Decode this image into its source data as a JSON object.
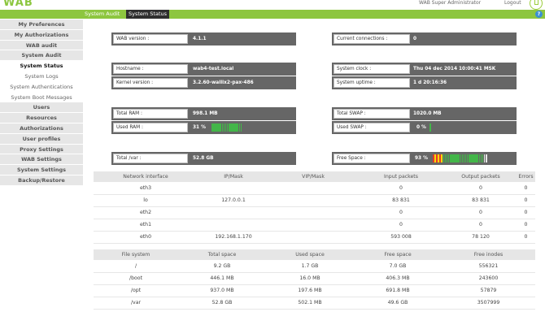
{
  "header": {
    "logo": "WAB",
    "user": "WAB Super Administrator",
    "logout": "Logout"
  },
  "menubar": {
    "crumbs": [
      "System Audit",
      "System Status"
    ],
    "help": "?"
  },
  "sidebar": {
    "items": [
      {
        "label": "My Preferences",
        "kind": "main"
      },
      {
        "label": "My Authorizations",
        "kind": "main"
      },
      {
        "label": "WAB audit",
        "kind": "main"
      },
      {
        "label": "System Audit",
        "kind": "main"
      },
      {
        "label": "System Status",
        "kind": "current"
      },
      {
        "label": "System Logs",
        "kind": "sub"
      },
      {
        "label": "System Authentications",
        "kind": "sub"
      },
      {
        "label": "System Boot Messages",
        "kind": "sub"
      },
      {
        "label": "Users",
        "kind": "main"
      },
      {
        "label": "Resources",
        "kind": "main"
      },
      {
        "label": "Authorizations",
        "kind": "main"
      },
      {
        "label": "User profiles",
        "kind": "main"
      },
      {
        "label": "Proxy Settings",
        "kind": "main"
      },
      {
        "label": "WAB Settings",
        "kind": "main"
      },
      {
        "label": "System Settings",
        "kind": "main"
      },
      {
        "label": "Backup/Restore",
        "kind": "main"
      }
    ]
  },
  "status": {
    "wab_version": {
      "label": "WAB version :",
      "value": "4.1.1"
    },
    "connections": {
      "label": "Current connections :",
      "value": "0"
    },
    "hostname": {
      "label": "Hostname :",
      "value": "wab4-test.local"
    },
    "kernel": {
      "label": "Kernel version :",
      "value": "3.2.60-wallix2-pax-486"
    },
    "clock": {
      "label": "System clock :",
      "value": "Thu 04 dec 2014 10:00:41 MSK"
    },
    "uptime": {
      "label": "System uptime :",
      "value": "1 d 20:16:36"
    },
    "total_ram": {
      "label": "Total RAM :",
      "value": "998.1 MB"
    },
    "used_ram": {
      "label": "Used RAM :",
      "value": "31 %",
      "level": 0.31
    },
    "total_swap": {
      "label": "Total SWAP :",
      "value": "1020.0 MB"
    },
    "used_swap": {
      "label": "Used SWAP :",
      "value": "0 %",
      "level": 0.0
    },
    "total_var": {
      "label": "Total /var :",
      "value": "52.8 GB"
    },
    "free_space": {
      "label": "Free Space :",
      "value": "93 %",
      "level": 0.93
    }
  },
  "network": {
    "headers": [
      "Network interface",
      "IP/Mask",
      "VIP/Mask",
      "Input packets",
      "Output packets",
      "Errors"
    ],
    "rows": [
      [
        "eth3",
        "",
        "",
        "0",
        "0",
        "0"
      ],
      [
        "lo",
        "127.0.0.1",
        "",
        "83 831",
        "83 831",
        "0"
      ],
      [
        "eth2",
        "",
        "",
        "0",
        "0",
        "0"
      ],
      [
        "eth1",
        "",
        "",
        "0",
        "0",
        "0"
      ],
      [
        "eth0",
        "192.168.1.170",
        "",
        "593 008",
        "78 120",
        "0"
      ]
    ]
  },
  "filesystems": {
    "headers": [
      "File system",
      "Total space",
      "Used space",
      "Free space",
      "Free inodes"
    ],
    "rows": [
      [
        "/",
        "9.2 GB",
        "1.7 GB",
        "7.0 GB",
        "556321"
      ],
      [
        "/boot",
        "446.1 MB",
        "16.0 MB",
        "406.3 MB",
        "243600"
      ],
      [
        "/opt",
        "937.0 MB",
        "197.6 MB",
        "691.8 MB",
        "57879"
      ],
      [
        "/var",
        "52.8 GB",
        "502.1 MB",
        "49.6 GB",
        "3507999"
      ]
    ]
  },
  "colors": {
    "accent": "#8dc63f",
    "block": "#666666",
    "gauge_green": "#43b649",
    "gauge_red": "#e53a2b",
    "gauge_yellow": "#f5d90a"
  }
}
